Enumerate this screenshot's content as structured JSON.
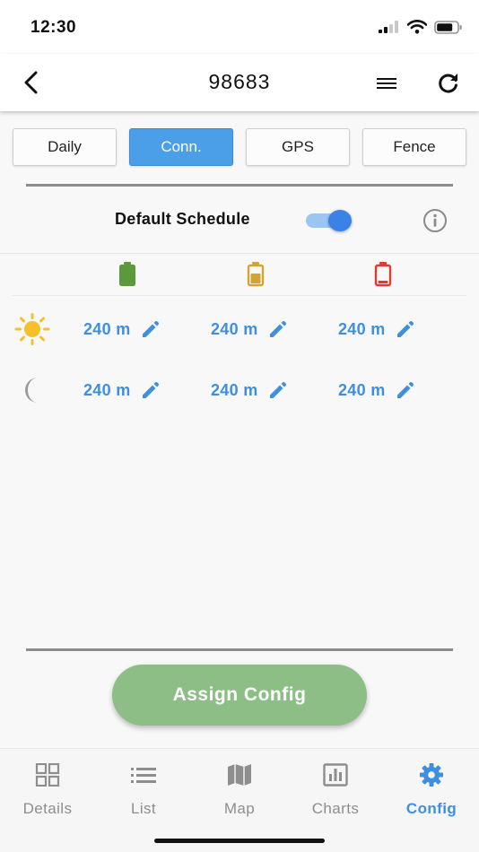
{
  "status_bar": {
    "time": "12:30"
  },
  "header": {
    "title": "98683"
  },
  "tabs": [
    {
      "label": "Daily",
      "active": false
    },
    {
      "label": "Conn.",
      "active": true
    },
    {
      "label": "GPS",
      "active": false
    },
    {
      "label": "Fence",
      "active": false
    }
  ],
  "schedule": {
    "label": "Default Schedule",
    "enabled": true
  },
  "battery_levels": [
    {
      "icon": "battery-full-icon",
      "color": "#5a9a3a"
    },
    {
      "icon": "battery-half-icon",
      "color": "#d2a531"
    },
    {
      "icon": "battery-low-icon",
      "color": "#e0392f"
    }
  ],
  "rows": {
    "day": {
      "icon": "sun-icon",
      "values": [
        "240 m",
        "240 m",
        "240 m"
      ]
    },
    "night": {
      "icon": "moon-icon",
      "values": [
        "240 m",
        "240 m",
        "240 m"
      ]
    }
  },
  "assign_button": {
    "label": "Assign Config"
  },
  "bottom_nav": [
    {
      "label": "Details",
      "icon": "grid-icon",
      "active": false
    },
    {
      "label": "List",
      "icon": "list-icon",
      "active": false
    },
    {
      "label": "Map",
      "icon": "map-icon",
      "active": false
    },
    {
      "label": "Charts",
      "icon": "chart-icon",
      "active": false
    },
    {
      "label": "Config",
      "icon": "gear-icon",
      "active": true
    }
  ],
  "colors": {
    "accent": "#3e8fe0",
    "tab_active": "#4a9fe8",
    "assign": "#8dbe86",
    "sun": "#f5c02a",
    "moon": "#9a9a9a"
  }
}
